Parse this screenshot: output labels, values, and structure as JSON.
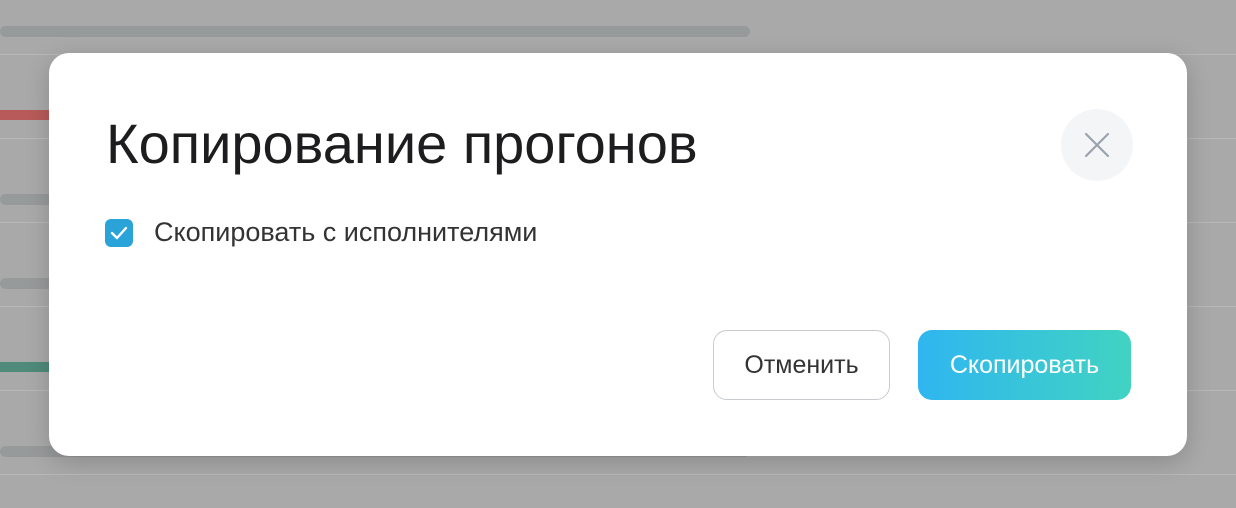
{
  "dialog": {
    "title": "Копирование прогонов",
    "close_icon": "close-icon",
    "checkbox": {
      "label": "Скопировать с исполнителями",
      "checked": true,
      "color": "#2aa3d8"
    },
    "cancel_label": "Отменить",
    "confirm_label": "Скопировать",
    "confirm_gradient": [
      "#2fb6f0",
      "#41d3c2"
    ]
  }
}
